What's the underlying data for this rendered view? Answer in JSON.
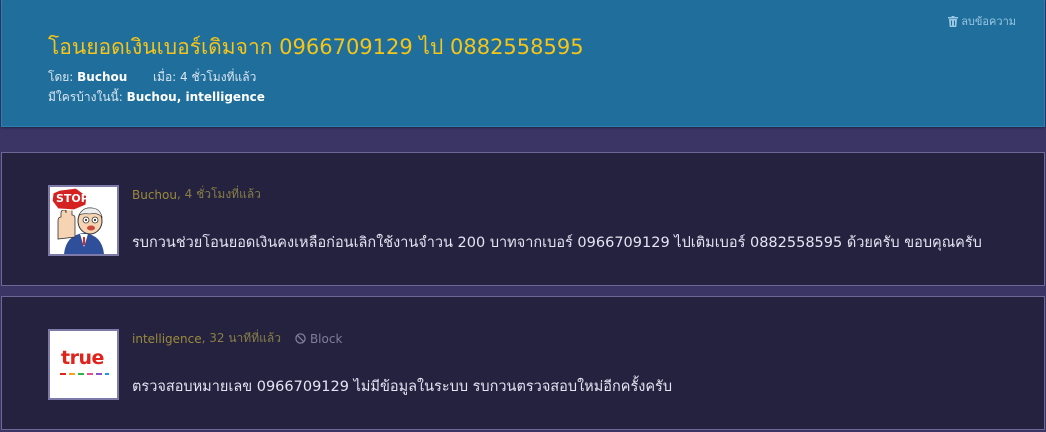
{
  "topic": {
    "title": "โอนยอดเงินเบอร์เดิมจาก 0966709129 ไป 0882558595",
    "delete_label": "ลบข้อความ",
    "by_label": "โดย:",
    "author": "Buchou",
    "when_label": "เมื่อ:",
    "when_value": "4 ชั่วโมงที่แล้ว",
    "participants_label": "มีใครบ้างในนี้:",
    "participants": "Buchou, intelligence"
  },
  "posts": [
    {
      "author": "Buchou",
      "time": ", 4 ชั่วโมงที่แล้ว",
      "avatar": "stop-sign-cartoon",
      "message": "รบกวนช่วยโอนยอดเงินคงเหลือก่อนเลิกใช้งานจำวน 200 บาทจากเบอร์ 0966709129 ไปเติมเบอร์ 0882558595 ด้วยครับ ขอบคุณครับ"
    },
    {
      "author": "intelligence",
      "time": ", 32 นาทีที่แล้ว",
      "block_label": "Block",
      "avatar": "true-logo",
      "avatar_text": "true",
      "message": "ตรวจสอบหมายเลข 0966709129 ไม่มีข้อมูลในระบบ รบกวนตรวจสอบใหม่อีกครั้งครับ"
    }
  ],
  "colors": {
    "page_bg": "#3b3566",
    "header_bg": "#1f6e9b",
    "title": "#f5c518",
    "post_bg": "#24223f",
    "author": "#9a8a3c",
    "true_red": "#e0241b"
  }
}
